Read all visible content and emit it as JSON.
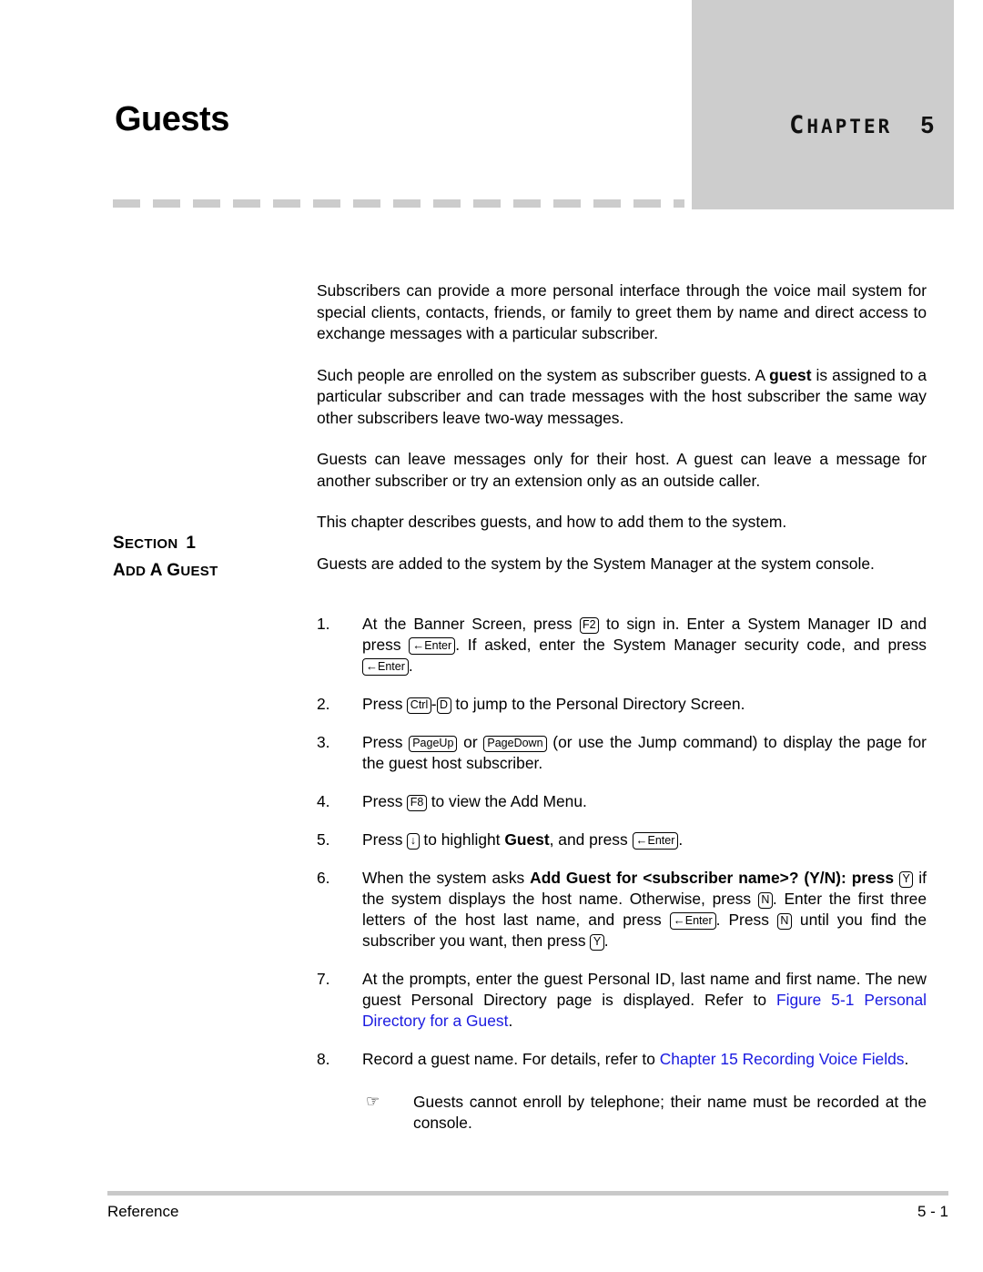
{
  "chapter": {
    "word": "CHAPTER",
    "number": "5",
    "box_color": "#cdcdcd"
  },
  "page_title": "Guests",
  "section": {
    "number_label": "SECTION 1",
    "name_label": "ADD A GUEST"
  },
  "intro": {
    "p1": "Subscribers can provide a more personal interface through the voice mail system for special clients, contacts, friends, or family to greet them by name and direct access to exchange messages with a particular subscriber.",
    "p2_a": "Such people are enrolled on the system as subscriber guests. A ",
    "p2_bold": "guest",
    "p2_b": " is assigned to a particular subscriber and can trade messages with the host subscriber the same way other subscribers leave two-way messages.",
    "p3": "Guests can leave messages only for their host. A guest can leave a message for another subscriber or try an extension only as an outside caller.",
    "p4": "This chapter describes guests, and how to add them to the system.",
    "p5": "Guests are added to the system by the System Manager at the system console."
  },
  "keys": {
    "f2": "F2",
    "f8": "F8",
    "enter": "Enter",
    "enter_arrow": "←",
    "ctrl": "Ctrl",
    "d": "D",
    "pageup": "PageUp",
    "pagedown": "PageDown",
    "down_arrow": "↓",
    "y": "Y",
    "n": "N"
  },
  "steps": [
    {
      "number": "1.",
      "t1": "At the Banner Screen, press ",
      "t2": " to sign in. Enter a System Manager ID and press ",
      "t3": ". If asked, enter the System Manager security code, and press ",
      "t4": "."
    },
    {
      "number": "2.",
      "t1": "Press ",
      "t2": "-",
      "t3": " to jump to the Personal Directory Screen."
    },
    {
      "number": "3.",
      "t1": "Press ",
      "t2": " or ",
      "t3": " (or use the Jump command) to display the page for the guest host subscriber."
    },
    {
      "number": "4.",
      "t1": "Press ",
      "t2": " to view the Add Menu."
    },
    {
      "number": "5.",
      "t1": "Press ",
      "t2": " to highlight ",
      "bold": "Guest",
      "t3": ", and press ",
      "t4": "."
    },
    {
      "number": "6.",
      "t1": "When the system asks ",
      "bold": "Add Guest for <subscriber name>? (Y/N)",
      "t2": ": press ",
      "t3": " if the system displays the host name. Otherwise, press ",
      "t4": ". Enter the first three letters of the host last name, and press ",
      "t5": ". Press ",
      "t6": " until you find the subscriber you want, then press ",
      "t7": "."
    },
    {
      "number": "7.",
      "t1": "At the prompts, enter the guest Personal ID, last name and first name. The new guest Personal Directory page is displayed. Refer to ",
      "link": "Figure 5-1 Personal Directory for a Guest",
      "t2": "."
    },
    {
      "number": "8.",
      "t1": "Record a guest name. For details, refer to ",
      "link": "Chapter 15 Recording Voice Fields",
      "t2": "."
    }
  ],
  "note": {
    "icon": "☞",
    "text": "Guests cannot enroll by telephone; their name must be recorded at the console."
  },
  "footer": {
    "left": "Reference",
    "right": "5 - 1"
  },
  "colors": {
    "link": "#1a1ae0",
    "rule": "#c9c9c9",
    "dash": "#cccccc"
  }
}
